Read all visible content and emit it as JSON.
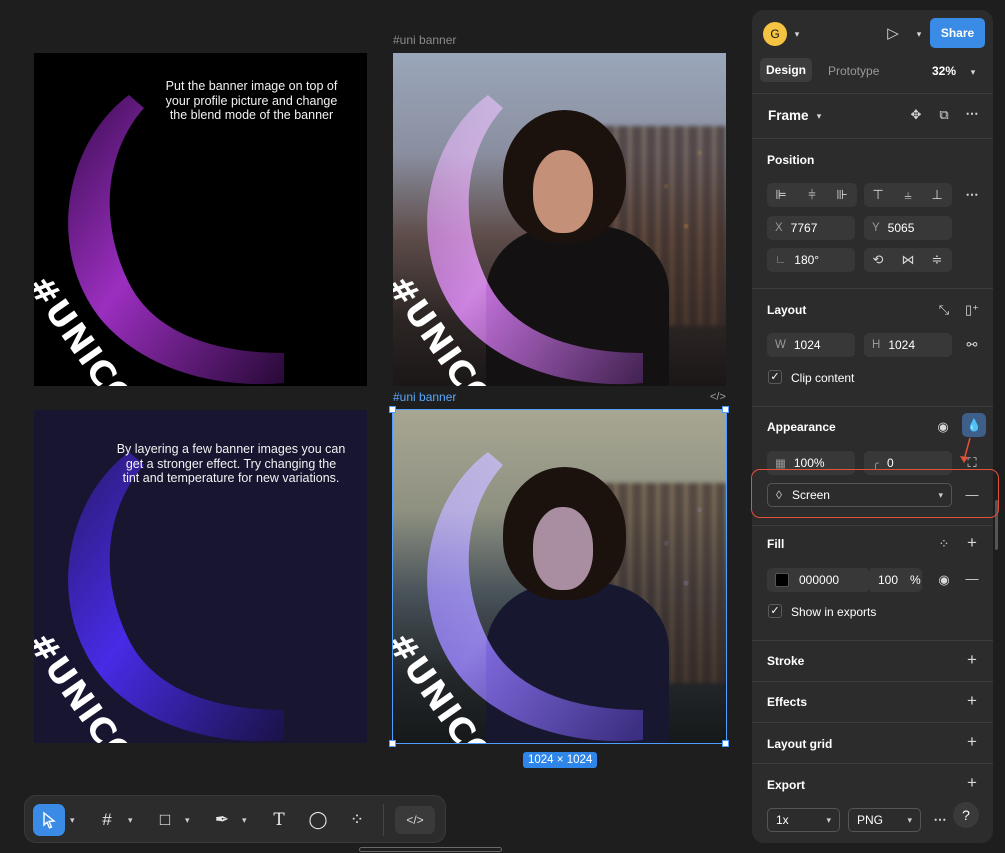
{
  "canvas": {
    "frame_top_right_label": "#uni banner",
    "frame_selected_label": "#uni banner",
    "frame1_caption": "Put the banner image on top of your profile picture and change the blend mode of the banner",
    "frame3_caption": "By layering a few banner images you can get a stronger effect. Try changing the tint and temperature for new variations.",
    "banner_text": "#UNICORN",
    "dimension_badge": "1024 × 1024",
    "code_tag": "</>"
  },
  "header": {
    "avatar_initial": "G",
    "share_label": "Share",
    "tabs": [
      "Design",
      "Prototype"
    ],
    "zoom": "32%"
  },
  "frame_section": {
    "title": "Frame"
  },
  "position": {
    "title": "Position",
    "x_label": "X",
    "x_value": "7767",
    "y_label": "Y",
    "y_value": "5065",
    "rotation": "180°"
  },
  "layout": {
    "title": "Layout",
    "w_label": "W",
    "w_value": "1024",
    "h_label": "H",
    "h_value": "1024",
    "clip_content": "Clip content"
  },
  "appearance": {
    "title": "Appearance",
    "opacity": "100%",
    "radius": "0",
    "blend_mode": "Screen"
  },
  "fill": {
    "title": "Fill",
    "hex": "000000",
    "opacity": "100",
    "percent": "%",
    "show_in_exports": "Show in exports",
    "swatch_color": "#000000"
  },
  "sections": {
    "stroke": "Stroke",
    "effects": "Effects",
    "layout_grid": "Layout grid",
    "export": "Export"
  },
  "export": {
    "scale": "1x",
    "format": "PNG"
  },
  "help": "?",
  "toolbar": {
    "tools": [
      "move-tool",
      "frame-tool",
      "shape-tool",
      "pen-tool",
      "text-tool",
      "comment-tool",
      "actions-tool"
    ],
    "code": "</>"
  },
  "colors": {
    "accent": "#3a8be5",
    "highlight": "#e4503c",
    "panel": "#2c2c2c",
    "canvas": "#1e1e1e"
  }
}
